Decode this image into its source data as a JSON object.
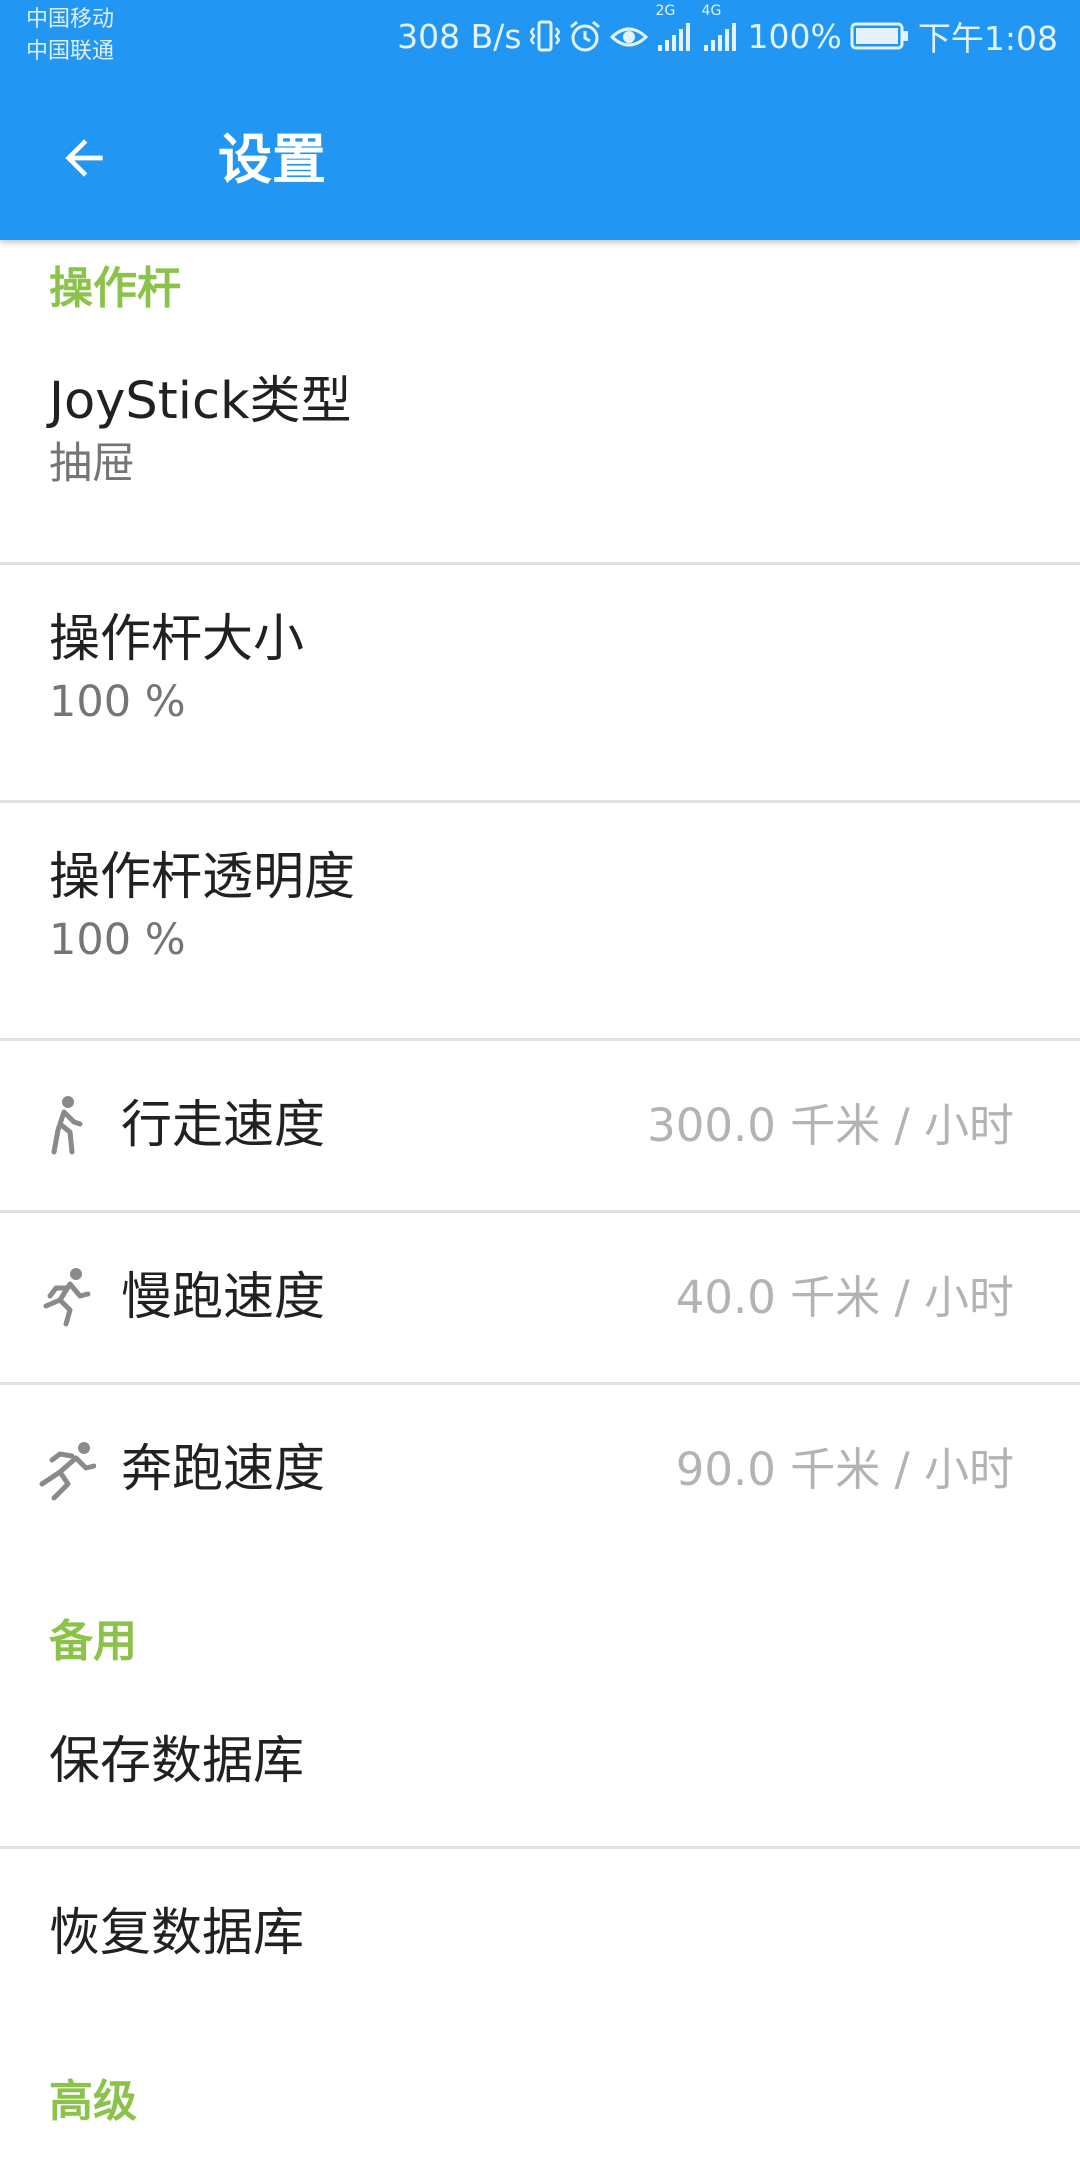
{
  "status_bar": {
    "carrier_1": "中国移动",
    "carrier_2": "中国联通",
    "net_speed": "308 B/s",
    "network_1": "2G",
    "network_2": "4G",
    "battery": "100%",
    "time": "下午1:08",
    "icons": [
      "vibrate-icon",
      "alarm-icon",
      "eye-comfort-icon",
      "signal-icon",
      "signal-icon",
      "battery-icon"
    ]
  },
  "toolbar": {
    "title": "设置",
    "back_icon": "arrow-back-icon",
    "background_color": "#2196F3"
  },
  "sections": {
    "joystick": {
      "header": "操作杆",
      "items": [
        {
          "title": "JoyStick类型",
          "summary": "抽屉"
        },
        {
          "title": "操作杆大小",
          "summary": "100 %"
        },
        {
          "title": "操作杆透明度",
          "summary": "100 %"
        }
      ],
      "speeds": [
        {
          "icon": "walk-icon",
          "title": "行走速度",
          "value": "300.0 千米 / 小时"
        },
        {
          "icon": "jog-icon",
          "title": "慢跑速度",
          "value": "40.0 千米 / 小时"
        },
        {
          "icon": "run-icon",
          "title": "奔跑速度",
          "value": "90.0 千米 / 小时"
        }
      ]
    },
    "backup": {
      "header": "备用",
      "items": [
        {
          "title": "保存数据库"
        },
        {
          "title": "恢复数据库"
        }
      ]
    },
    "advanced": {
      "header": "高级"
    }
  },
  "colors": {
    "accent": "#8BC34A",
    "primary": "#2196F3",
    "divider": "#e0e0e0"
  }
}
